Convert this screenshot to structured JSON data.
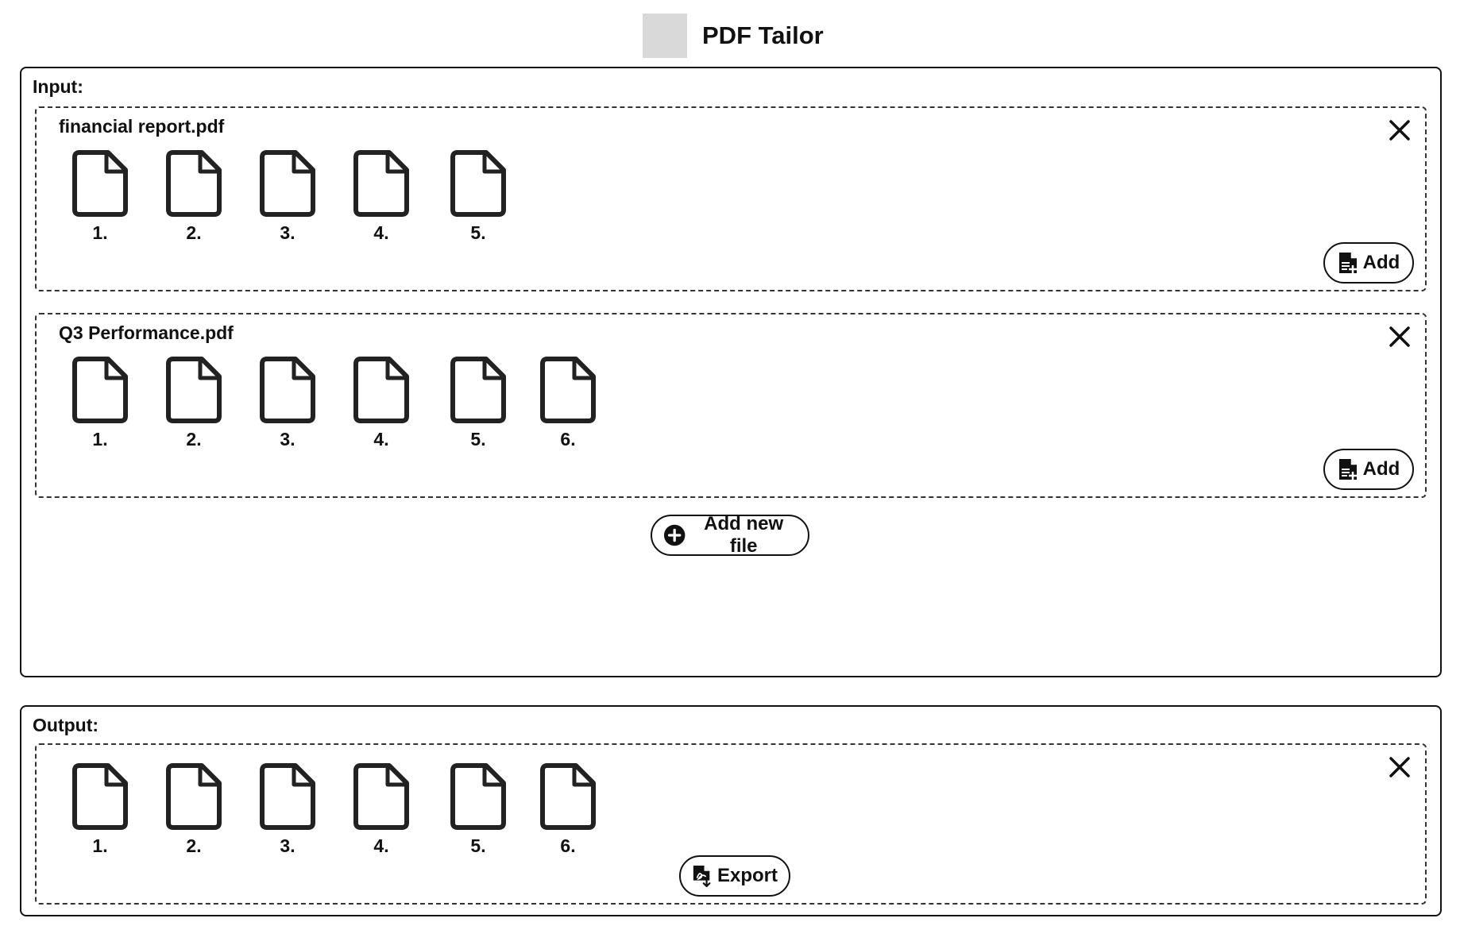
{
  "app": {
    "title": "PDF Tailor"
  },
  "input": {
    "label": "Input:",
    "files": [
      {
        "name": "financial report.pdf",
        "pages": [
          "1.",
          "2.",
          "3.",
          "4.",
          "5."
        ],
        "add_label": "Add"
      },
      {
        "name": "Q3 Performance.pdf",
        "pages": [
          "1.",
          "2.",
          "3.",
          "4.",
          "5.",
          "6."
        ],
        "add_label": "Add"
      }
    ],
    "add_new_file_label": "Add new file"
  },
  "output": {
    "label": "Output:",
    "pages": [
      "1.",
      "2.",
      "3.",
      "4.",
      "5.",
      "6."
    ],
    "export_label": "Export"
  },
  "icons": {
    "logo": "logo-placeholder",
    "close": "close-icon",
    "page": "document-page-icon",
    "add": "file-add-icon",
    "add_new_file": "plus-circle-icon",
    "export": "pdf-export-icon"
  }
}
